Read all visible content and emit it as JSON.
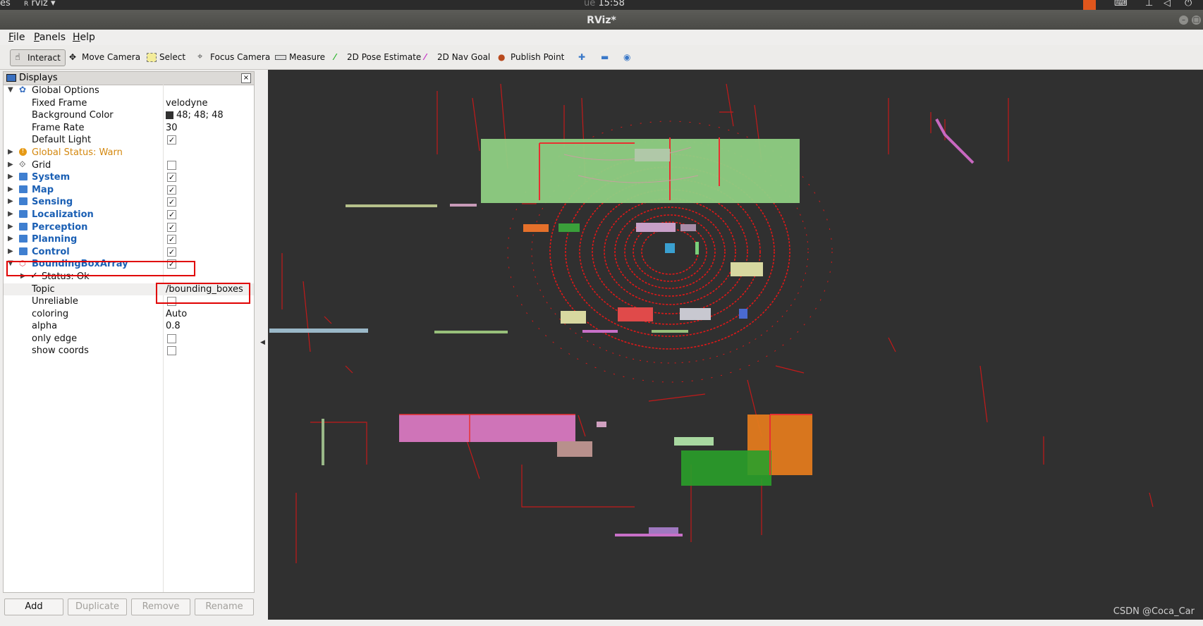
{
  "system_bar": {
    "left_label": "es",
    "app_label": "rviz",
    "time": "15:58",
    "day_fragment": "ue"
  },
  "window": {
    "title": "RViz*"
  },
  "menu": {
    "file": "File",
    "panels": "Panels",
    "help": "Help"
  },
  "toolbar": {
    "interact": "Interact",
    "move_camera": "Move Camera",
    "select": "Select",
    "focus_camera": "Focus Camera",
    "measure": "Measure",
    "pose_estimate": "2D Pose Estimate",
    "nav_goal": "2D Nav Goal",
    "publish_point": "Publish Point"
  },
  "displays": {
    "header": "Displays",
    "close": "×",
    "global_options": {
      "label": "Global Options",
      "fixed_frame": {
        "label": "Fixed Frame",
        "value": "velodyne"
      },
      "background_color": {
        "label": "Background Color",
        "value": "48; 48; 48",
        "swatch": "#303030"
      },
      "frame_rate": {
        "label": "Frame Rate",
        "value": "30"
      },
      "default_light": {
        "label": "Default Light",
        "checked": true
      }
    },
    "global_status": "Global Status: Warn",
    "grid": {
      "label": "Grid",
      "checked": false
    },
    "groups": [
      {
        "label": "System",
        "checked": true
      },
      {
        "label": "Map",
        "checked": true
      },
      {
        "label": "Sensing",
        "checked": true
      },
      {
        "label": "Localization",
        "checked": true
      },
      {
        "label": "Perception",
        "checked": true
      },
      {
        "label": "Planning",
        "checked": true
      },
      {
        "label": "Control",
        "checked": true
      }
    ],
    "bbox": {
      "label": "BoundingBoxArray",
      "checked": true,
      "status": "Status: Ok",
      "topic": {
        "label": "Topic",
        "value": "/bounding_boxes"
      },
      "unreliable": {
        "label": "Unreliable",
        "checked": false
      },
      "coloring": {
        "label": "coloring",
        "value": "Auto"
      },
      "alpha": {
        "label": "alpha",
        "value": "0.8"
      },
      "only_edge": {
        "label": "only edge",
        "checked": false
      },
      "show_coords": {
        "label": "show coords",
        "checked": false
      }
    }
  },
  "buttons": {
    "add": "Add",
    "duplicate": "Duplicate",
    "remove": "Remove",
    "rename": "Rename"
  },
  "viewport": {
    "background": "#303030",
    "watermark": "CSDN @Coca_Car"
  },
  "colors": {
    "pointcloud": "#e01818",
    "highlight": "#e00000"
  }
}
